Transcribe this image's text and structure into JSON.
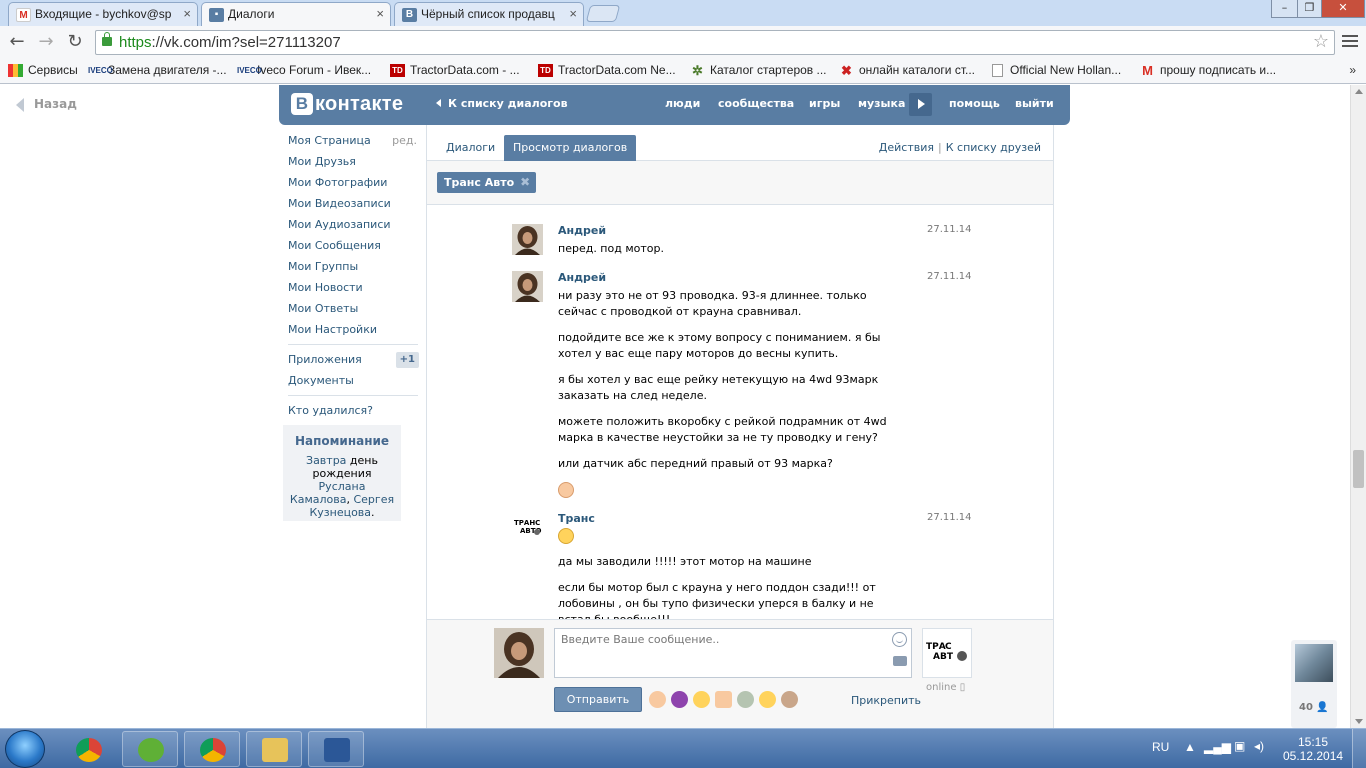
{
  "browser": {
    "tabs": [
      {
        "label": "Входящие - bychkov@sp",
        "icon": "gmail-icon"
      },
      {
        "label": "Диалоги",
        "icon": "vk-icon"
      },
      {
        "label": "Чёрный список продавц",
        "icon": "vk-icon"
      }
    ],
    "url_scheme": "https",
    "url_rest": "://vk.com/im?sel=271113207",
    "bookmarks": [
      "Сервисы",
      "Замена двигателя -...",
      "Iveco Forum - Ивек...",
      "TractorData.com - ...",
      "TractorData.com Ne...",
      "Каталог стартеров ...",
      "онлайн каталоги ст...",
      "Official New Hollan...",
      "прошу подписать и..."
    ],
    "bookmarks_more": "»"
  },
  "vk": {
    "back": "Назад",
    "logo": "контакте",
    "logo_letter": "В",
    "to_dialogs": "К списку диалогов",
    "nav": [
      "люди",
      "сообщества",
      "игры",
      "музыка",
      "помощь",
      "выйти"
    ],
    "menu": [
      {
        "label": "Моя Страница",
        "extra": "ред."
      },
      {
        "label": "Мои Друзья"
      },
      {
        "label": "Мои Фотографии"
      },
      {
        "label": "Мои Видеозаписи"
      },
      {
        "label": "Мои Аудиозаписи"
      },
      {
        "label": "Мои Сообщения"
      },
      {
        "label": "Мои Группы"
      },
      {
        "label": "Мои Новости"
      },
      {
        "label": "Мои Ответы"
      },
      {
        "label": "Мои Настройки"
      }
    ],
    "menu2": [
      {
        "label": "Приложения",
        "count": "+1"
      },
      {
        "label": "Документы"
      }
    ],
    "menu3": "Кто удалился?",
    "reminder": {
      "title": "Напоминание",
      "w1": "Завтра",
      "t1": " день рождения ",
      "w2": "Руслана Камалова",
      "t2": ", ",
      "w3": "Сергея Кузнецова",
      "t3": "."
    },
    "tabs": [
      "Диалоги",
      "Просмотр диалогов"
    ],
    "actions": "Действия",
    "actions_sep": "|",
    "friends_list": "К списку друзей",
    "peer": "Транс Авто",
    "peer_close": "✖",
    "messages": [
      {
        "author": "Андрей",
        "date": "27.11.14",
        "paras": [
          "перед. под мотор."
        ]
      },
      {
        "author": "Андрей",
        "date": "27.11.14",
        "paras": [
          "ни разу это не от 93 проводка. 93-я длиннее. только сейчас с проводкой от крауна сравнивал.",
          "подойдите все же к этому вопросу с пониманием. я бы хотел у вас еще пару моторов до весны купить.",
          "я бы хотел у вас еще рейку нетекущую на 4wd 93марк заказать на след неделе.",
          "можете положить вкоробку с рейкой подрамник от 4wd марка в качестве неустойки за не ту проводку и гену?",
          "или датчик абс передний правый от 93 марка?"
        ]
      },
      {
        "author": "Транс",
        "date": "27.11.14",
        "paras": [
          "да мы заводили !!!!! этот мотор на машине",
          "если бы мотор был с крауна у него поддон сзади!!! от лобовины , он бы тупо физически уперся в балку и не встал бы вообще!!!"
        ]
      }
    ],
    "input_placeholder": "Введите Ваше сообщение..",
    "send": "Отправить",
    "attach": "Прикрепить",
    "online": "online",
    "peer_logo": "ТРАНС АВТО",
    "chat_count": "40"
  },
  "taskbar": {
    "lang": "RU",
    "time": "15:15",
    "date": "05.12.2014"
  }
}
